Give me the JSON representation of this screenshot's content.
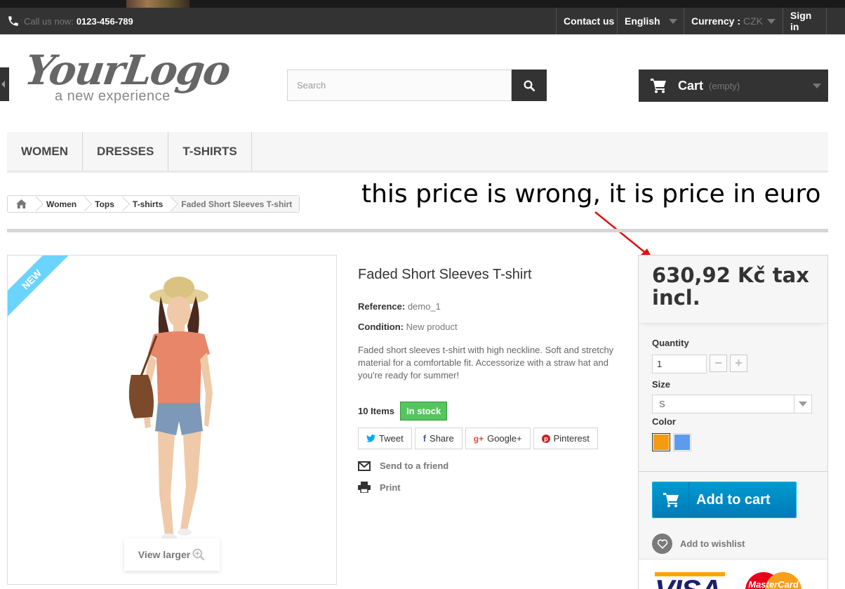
{
  "topbar": {
    "call_label": "Call us now:",
    "phone": "0123-456-789",
    "contact": "Contact us",
    "language": "English",
    "currency_label": "Currency :",
    "currency_value": "CZK",
    "signin": "Sign in"
  },
  "header": {
    "logo_text": "YourLogo",
    "logo_tagline": "a new experience",
    "search_placeholder": "Search",
    "cart_label": "Cart",
    "cart_status": "(empty)"
  },
  "menu": [
    "Women",
    "Dresses",
    "T-shirts"
  ],
  "breadcrumb": [
    "Women",
    "Tops",
    "T-shirts",
    "Faded Short Sleeves T-shirt"
  ],
  "annotation": "this price is wrong, it is price in euro",
  "product": {
    "badge": "NEW",
    "view_larger": "View larger",
    "title": "Faded Short Sleeves T-shirt",
    "reference_label": "Reference:",
    "reference_value": "demo_1",
    "condition_label": "Condition:",
    "condition_value": "New product",
    "description": "Faded short sleeves t-shirt with high neckline. Soft and stretchy material for a comfortable fit. Accessorize with a straw hat and you're ready for summer!",
    "items": "10 Items",
    "stock": "In stock",
    "share": [
      "Tweet",
      "Share",
      "Google+",
      "Pinterest"
    ],
    "send_friend": "Send to a friend",
    "print": "Print"
  },
  "buy": {
    "price": "630,92 Kč tax incl.",
    "quantity_label": "Quantity",
    "quantity_value": "1",
    "size_label": "Size",
    "size_value": "S",
    "color_label": "Color",
    "colors": [
      "#f39c11",
      "#5d9cec"
    ],
    "add_to_cart": "Add to cart",
    "wishlist": "Add to wishlist",
    "card_visa": "VISA",
    "card_mc": "MasterCard"
  }
}
